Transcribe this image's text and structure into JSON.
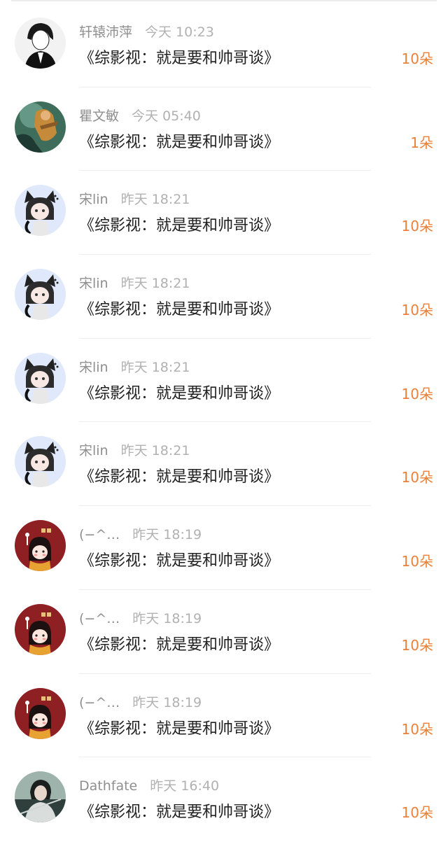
{
  "gifts": [
    {
      "user": "轩辕沛萍",
      "time": "今天 10:23",
      "title": "《综影视：就是要和帅哥谈》",
      "count": "10朵",
      "avatar": "avatar-bw-man-icon"
    },
    {
      "user": "瞿文敏",
      "time": "今天 05:40",
      "title": "《综影视：就是要和帅哥谈》",
      "count": "1朵",
      "avatar": "avatar-game-hero-icon"
    },
    {
      "user": "宋lin",
      "time": "昨天 18:21",
      "title": "《综影视：就是要和帅哥谈》",
      "count": "10朵",
      "avatar": "avatar-cat-girl-icon"
    },
    {
      "user": "宋lin",
      "time": "昨天 18:21",
      "title": "《综影视：就是要和帅哥谈》",
      "count": "10朵",
      "avatar": "avatar-cat-girl-icon"
    },
    {
      "user": "宋lin",
      "time": "昨天 18:21",
      "title": "《综影视：就是要和帅哥谈》",
      "count": "10朵",
      "avatar": "avatar-cat-girl-icon"
    },
    {
      "user": "宋lin",
      "time": "昨天 18:21",
      "title": "《综影视：就是要和帅哥谈》",
      "count": "10朵",
      "avatar": "avatar-cat-girl-icon"
    },
    {
      "user": "(−^…",
      "time": "昨天 18:19",
      "title": "《综影视：就是要和帅哥谈》",
      "count": "10朵",
      "avatar": "avatar-red-girl-icon"
    },
    {
      "user": "(−^…",
      "time": "昨天 18:19",
      "title": "《综影视：就是要和帅哥谈》",
      "count": "10朵",
      "avatar": "avatar-red-girl-icon"
    },
    {
      "user": "(−^…",
      "time": "昨天 18:19",
      "title": "《综影视：就是要和帅哥谈》",
      "count": "10朵",
      "avatar": "avatar-red-girl-icon"
    },
    {
      "user": "Dathfate",
      "time": "昨天 16:40",
      "title": "《综影视：就是要和帅哥谈》",
      "count": "10朵",
      "avatar": "avatar-swordsman-icon"
    }
  ],
  "colors": {
    "count": "#e9813a",
    "title": "#222222",
    "meta": "#a9a9a9"
  }
}
